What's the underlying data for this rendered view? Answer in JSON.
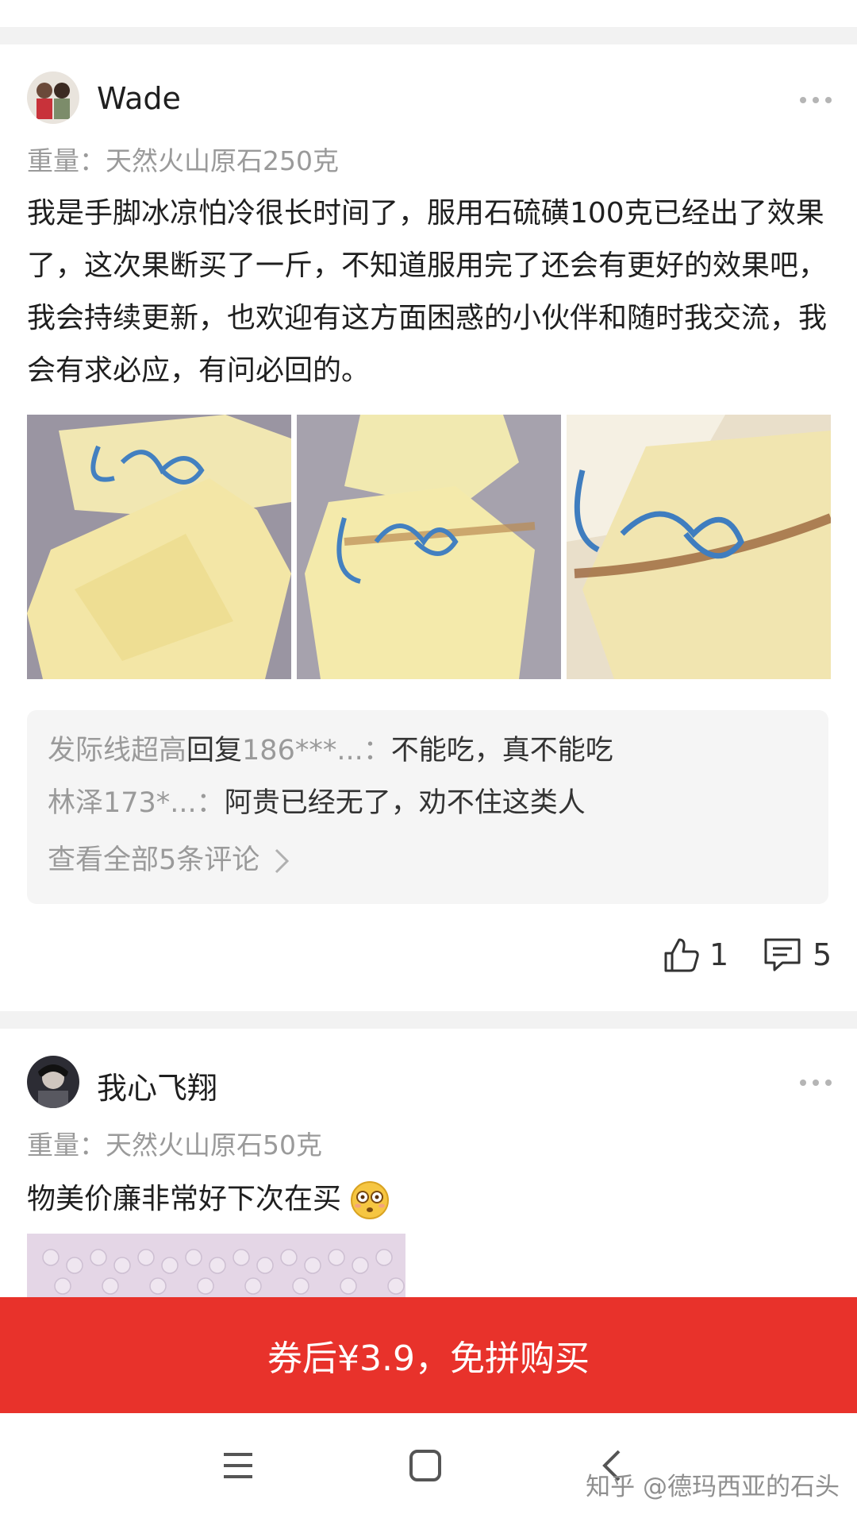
{
  "reviews": [
    {
      "username": "Wade",
      "sku": "重量：天然火山原石250克",
      "content": "我是手脚冰凉怕冷很长时间了，服用石硫磺100克已经出了效果了，这次果断买了一斤，不知道服用完了还会有更好的效果吧，我会持续更新，也欢迎有这方面困惑的小伙伴和随时我交流，我会有求必应，有问必回的。",
      "replies": [
        {
          "author": "发际线超高",
          "reply_word": "回复",
          "target": "186***...：",
          "text": "不能吃，真不能吃"
        },
        {
          "author": "林泽173*...：",
          "text": "阿贵已经无了，劝不住这类人"
        }
      ],
      "view_all": "查看全部5条评论",
      "likes": "1",
      "comments": "5"
    },
    {
      "username": "我心飞翔",
      "sku": "重量：天然火山原石50克",
      "content": "物美价廉非常好下次在买"
    }
  ],
  "buy_button": "券后¥3.9，免拼购买",
  "watermark": "知乎 @德玛西亚的石头",
  "colors": {
    "accent": "#e8322b",
    "muted_text": "#9a9a9a",
    "reply_bg": "#f5f5f5"
  }
}
